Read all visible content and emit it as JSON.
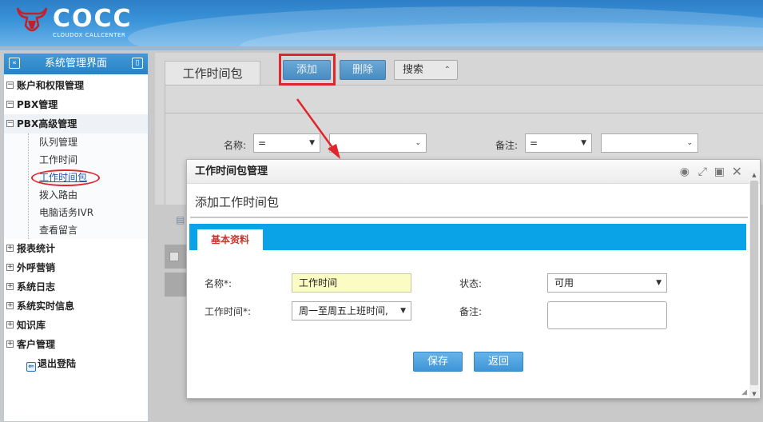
{
  "header": {
    "logo_text": "COCC",
    "logo_sub": "CLOUDOX CALLCENTER"
  },
  "sidebar": {
    "title": "系统管理界面",
    "items": [
      {
        "label": "账户和权限管理",
        "toggle": "−"
      },
      {
        "label": "PBX管理",
        "toggle": "−"
      },
      {
        "label": "PBX高级管理",
        "toggle": "−"
      }
    ],
    "pbx_children": [
      "队列管理",
      "工作时间",
      "工作时间包",
      "拨入路由",
      "电脑话务IVR",
      "查看留言"
    ],
    "items_after": [
      {
        "label": "报表统计",
        "toggle": "+"
      },
      {
        "label": "外呼营销",
        "toggle": "+"
      },
      {
        "label": "系统日志",
        "toggle": "+"
      },
      {
        "label": "系统实时信息",
        "toggle": "+"
      },
      {
        "label": "知识库",
        "toggle": "+"
      },
      {
        "label": "客户管理",
        "toggle": "+"
      }
    ],
    "logout": "退出登陆"
  },
  "main": {
    "page_tab": "工作时间包",
    "add_button": "添加",
    "delete_button": "删除",
    "search_button": "搜索",
    "filter_name_label": "名称:",
    "filter_name_op": "=",
    "filter_note_label": "备注:",
    "filter_note_op": "="
  },
  "modal": {
    "title": "工作时间包管理",
    "subtitle": "添加工作时间包",
    "tab": "基本资料",
    "name_label": "名称*:",
    "name_value": "工作时间",
    "worktime_label": "工作时间*:",
    "worktime_value": "周一至周五上班时间,",
    "status_label": "状态:",
    "status_value": "可用",
    "note_label": "备注:",
    "note_value": "",
    "save_button": "保存",
    "back_button": "返回"
  },
  "colors": {
    "header_blue": "#2d7fc6",
    "tab_bar": "#0aa3e8",
    "highlight_red": "#e0262b",
    "name_field_bg": "#fbfbc4"
  }
}
